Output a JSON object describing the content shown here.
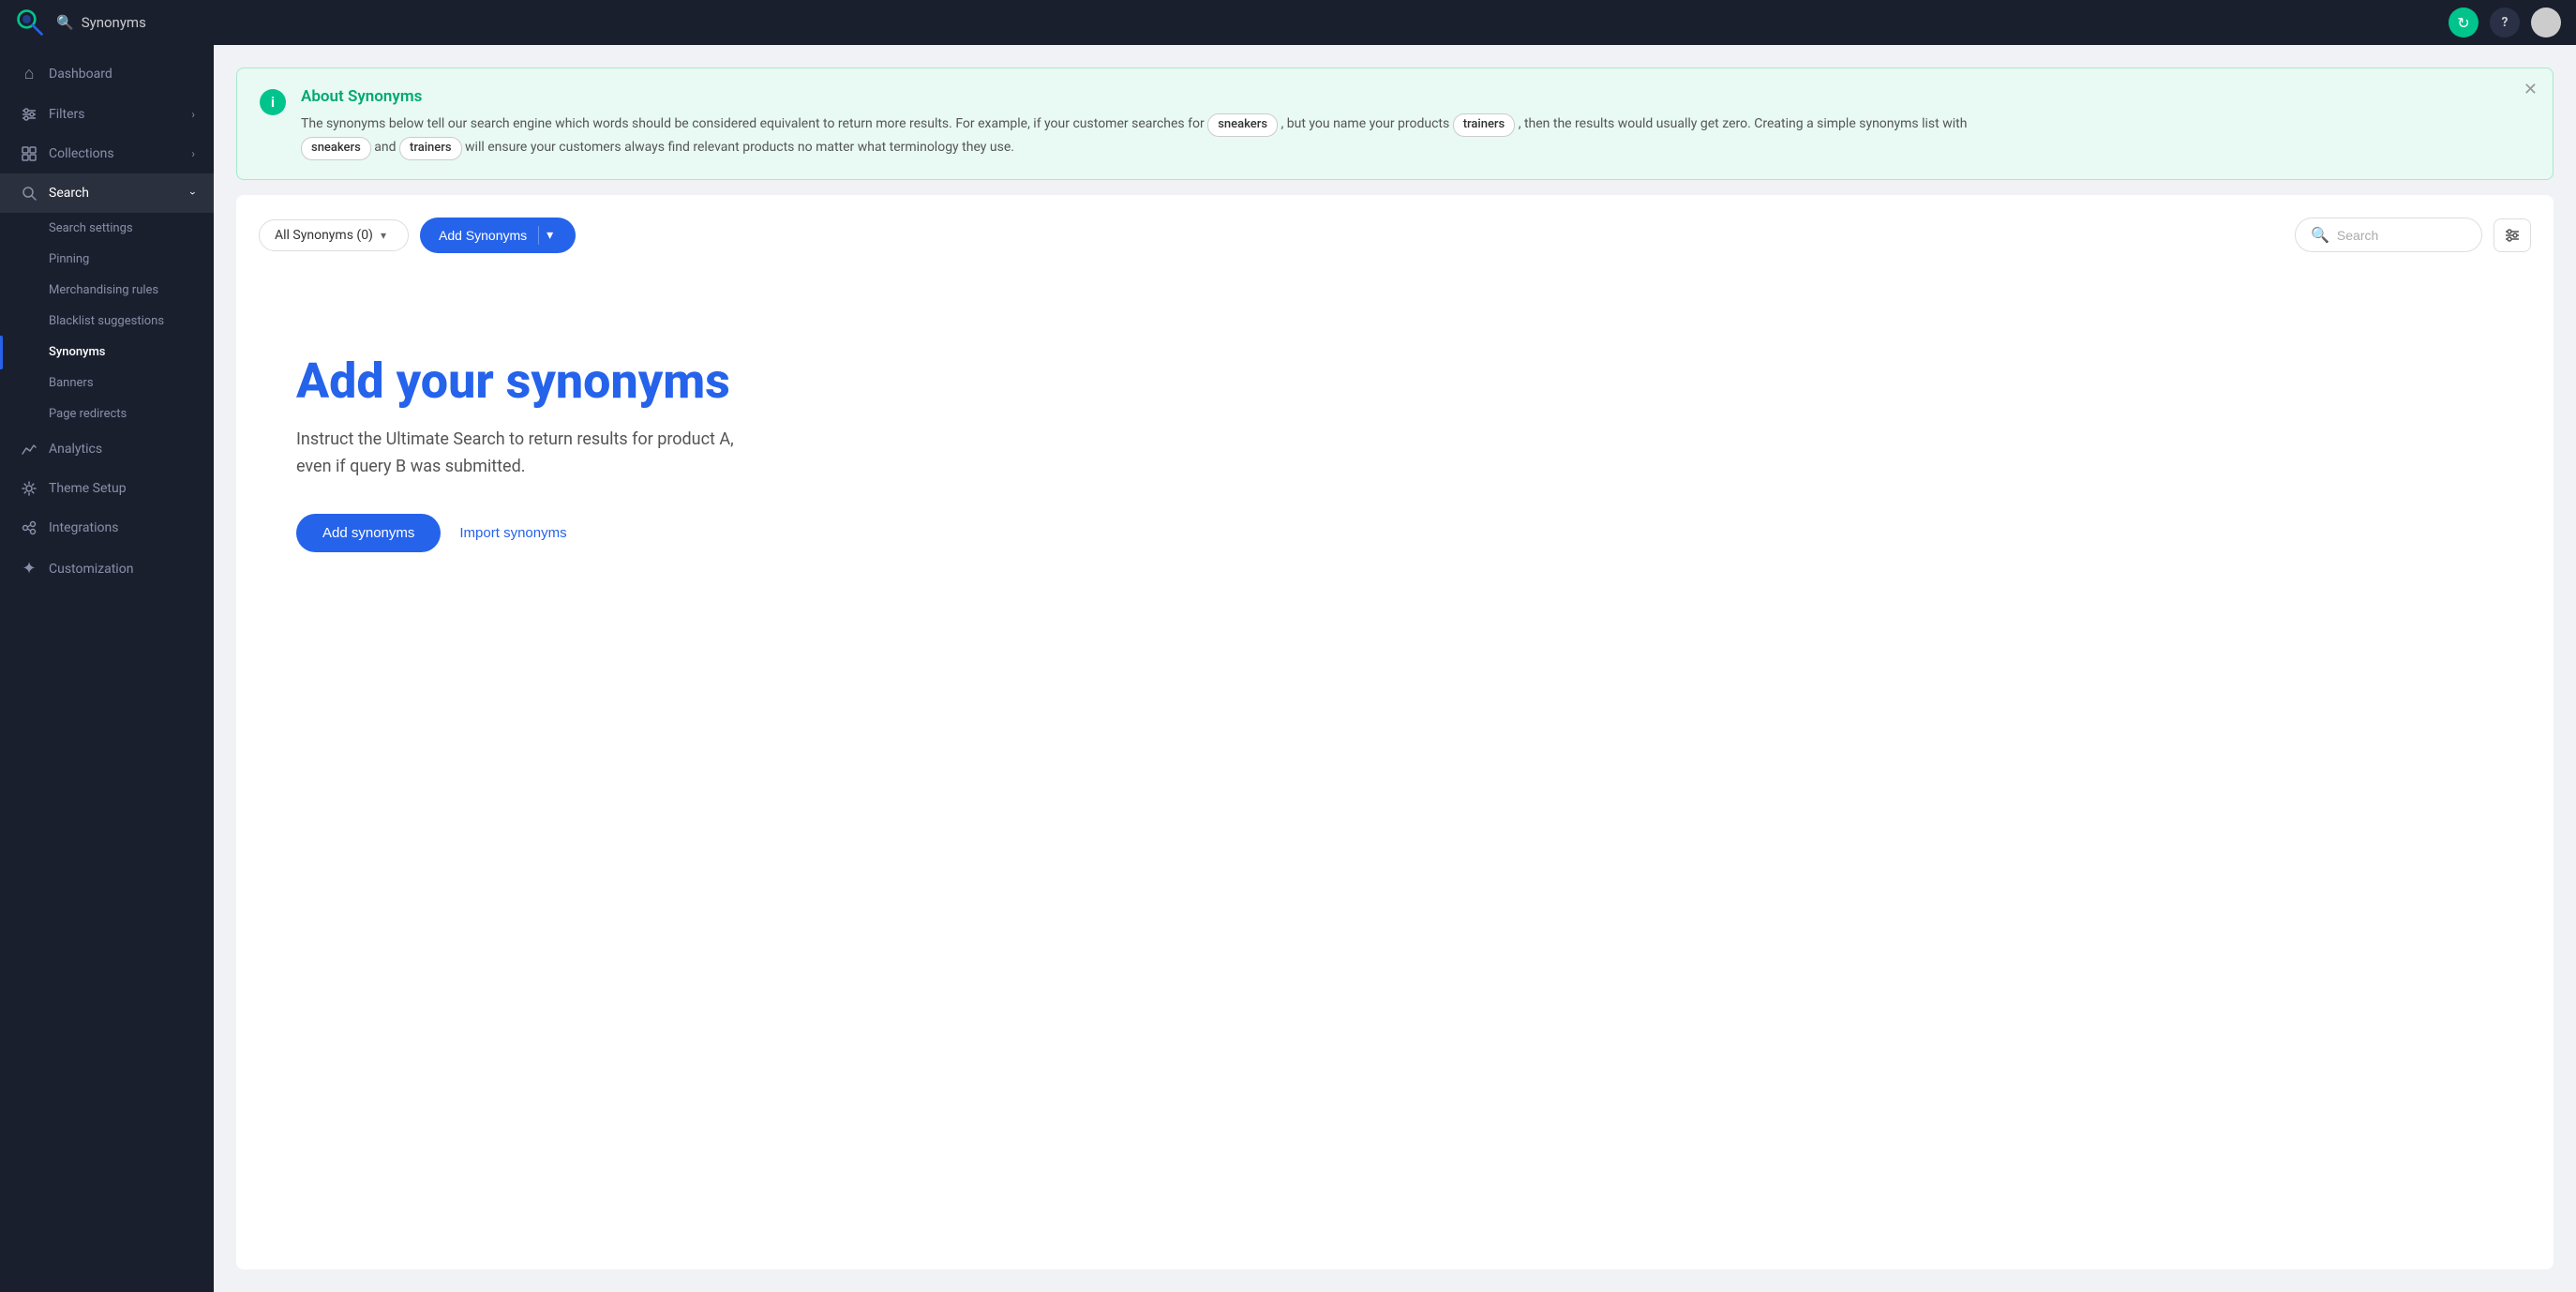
{
  "topbar": {
    "title": "Synonyms",
    "logo_icon": "🔍"
  },
  "sidebar": {
    "items": [
      {
        "id": "dashboard",
        "label": "Dashboard",
        "icon": "⌂",
        "has_children": false
      },
      {
        "id": "filters",
        "label": "Filters",
        "icon": "⚙",
        "has_children": true,
        "chevron": "›"
      },
      {
        "id": "collections",
        "label": "Collections",
        "icon": "📅",
        "has_children": true,
        "chevron": "›"
      },
      {
        "id": "search",
        "label": "Search",
        "icon": "🔍",
        "has_children": true,
        "open": true
      },
      {
        "id": "analytics",
        "label": "Analytics",
        "icon": "📈",
        "has_children": false
      },
      {
        "id": "theme-setup",
        "label": "Theme Setup",
        "icon": "🎨",
        "has_children": false
      },
      {
        "id": "integrations",
        "label": "Integrations",
        "icon": "🔗",
        "has_children": false
      },
      {
        "id": "customization",
        "label": "Customization",
        "icon": "✦",
        "has_children": false
      }
    ],
    "search_sub_items": [
      {
        "id": "search-settings",
        "label": "Search settings"
      },
      {
        "id": "pinning",
        "label": "Pinning"
      },
      {
        "id": "merchandising-rules",
        "label": "Merchandising rules"
      },
      {
        "id": "blacklist-suggestions",
        "label": "Blacklist suggestions"
      },
      {
        "id": "synonyms",
        "label": "Synonyms",
        "active": true
      },
      {
        "id": "banners",
        "label": "Banners"
      },
      {
        "id": "page-redirects",
        "label": "Page redirects"
      }
    ]
  },
  "info_banner": {
    "title": "About Synonyms",
    "text_before": "The synonyms below tell our search engine which words should be considered equivalent to return more results. For example, if your customer searches for",
    "tag1": "sneakers",
    "text_middle1": ", but you name your products",
    "tag2": "trainers",
    "text_middle2": ", then the results would usually get zero. Creating a simple synonyms list with",
    "tag3": "sneakers",
    "text_and": "and",
    "tag4": "trainers",
    "text_end": "will ensure your customers always find relevant products no matter what terminology they use.",
    "close_icon": "✕"
  },
  "toolbar": {
    "select_label": "All Synonyms (0)",
    "add_btn_label": "Add Synonyms",
    "search_placeholder": "Search",
    "filter_icon": "⊞"
  },
  "empty_state": {
    "title": "Add your synonyms",
    "description": "Instruct the Ultimate Search to return results for product A, even if query B was submitted.",
    "add_btn": "Add synonyms",
    "import_btn": "Import synonyms"
  }
}
